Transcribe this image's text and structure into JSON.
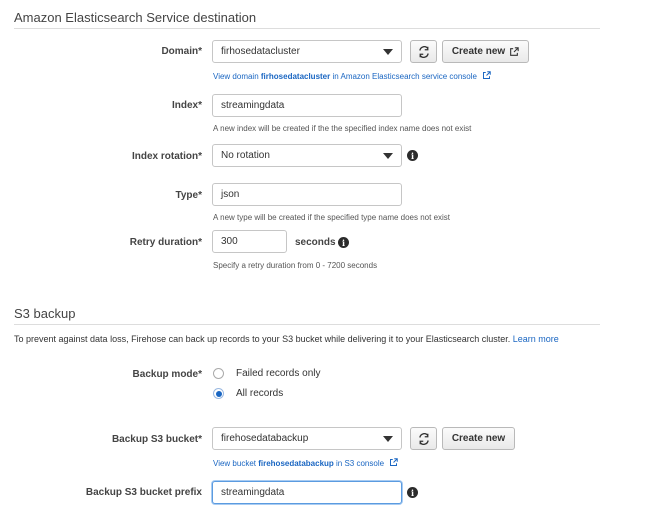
{
  "es_section": {
    "title": "Amazon Elasticsearch Service destination",
    "domain": {
      "label": "Domain*",
      "value": "firhosedatacluster",
      "create_label": "Create new",
      "link_prefix": "View domain ",
      "link_bold": "firhosedatacluster",
      "link_suffix": " in Amazon Elasticsearch service console"
    },
    "index": {
      "label": "Index*",
      "value": "streamingdata",
      "hint": "A new index will be created if the the specified index name does not exist"
    },
    "index_rotation": {
      "label": "Index rotation*",
      "value": "No rotation"
    },
    "type": {
      "label": "Type*",
      "value": "json",
      "hint": "A new type will be created if the specified type name does not exist"
    },
    "retry": {
      "label": "Retry duration*",
      "value": "300",
      "unit": "seconds",
      "hint": "Specify a retry duration from 0 - 7200 seconds"
    }
  },
  "s3_section": {
    "title": "S3 backup",
    "description": "To prevent against data loss, Firehose can back up records to your S3 bucket while delivering it to your Elasticsearch cluster.",
    "learn_more": "Learn more",
    "backup_mode": {
      "label": "Backup mode*",
      "options": [
        {
          "label": "Failed records only",
          "checked": false
        },
        {
          "label": "All records",
          "checked": true
        }
      ]
    },
    "bucket": {
      "label": "Backup S3 bucket*",
      "value": "firehosedatabackup",
      "create_label": "Create new",
      "link_prefix": "View bucket ",
      "link_bold": "firehosedatabackup",
      "link_suffix": " in S3 console"
    },
    "prefix": {
      "label": "Backup S3 bucket prefix",
      "value": "streamingdata"
    }
  },
  "icons": {
    "refresh": "refresh-icon",
    "external": "external-link-icon",
    "info": "info-icon",
    "dropdown": "chevron-down-icon"
  },
  "colors": {
    "link": "#1a66c2",
    "focus": "#5b9be0",
    "radio_selected": "#1a66c2"
  }
}
